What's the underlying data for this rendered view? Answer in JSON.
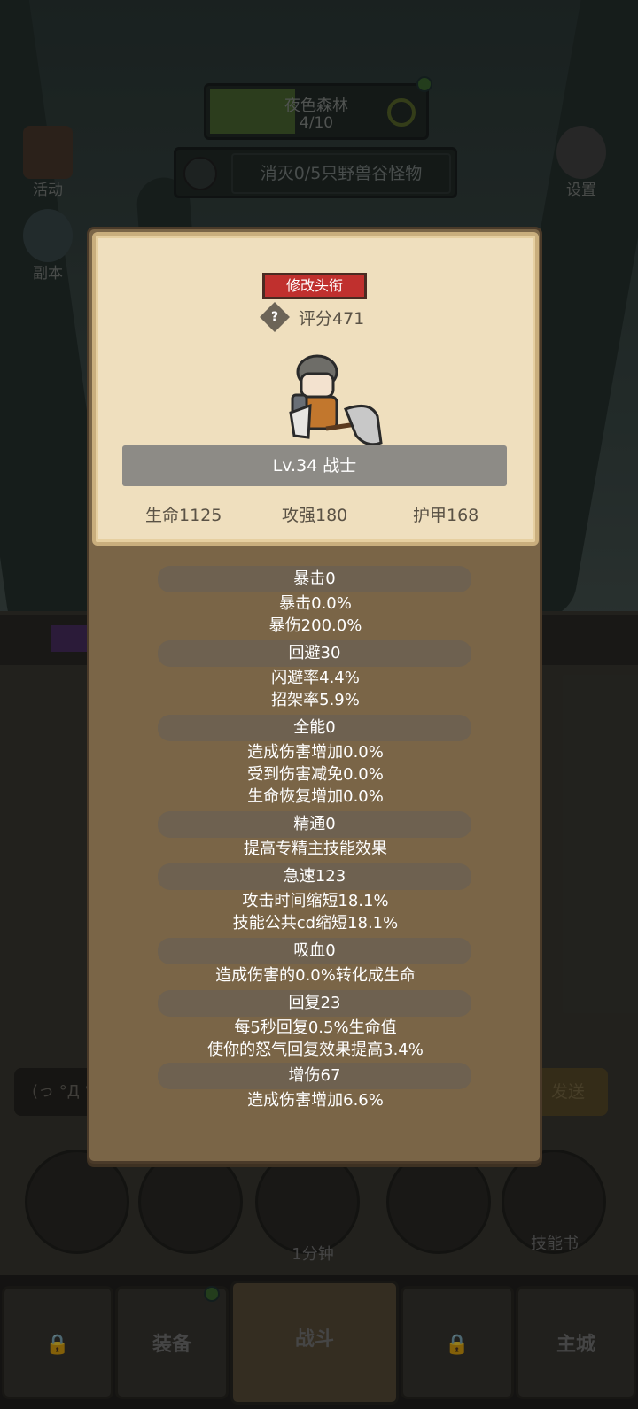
{
  "stage": {
    "name": "夜色森林",
    "progress": "4/10"
  },
  "quest": {
    "text": "消灭0/5只野兽谷怪物"
  },
  "side_left": [
    {
      "label": "活动",
      "icon": "calendar-icon"
    },
    {
      "label": "副本",
      "icon": "portal-icon"
    }
  ],
  "side_right": {
    "label": "设置",
    "icon": "gear-icon"
  },
  "chat": {
    "text": "(っ °Д °",
    "send_label": "发送"
  },
  "bottom_circles": {
    "timer_label": "1分钟",
    "skillbook_label": "技能书"
  },
  "nav": {
    "equipment": "装备",
    "battle": "战斗",
    "city": "主城"
  },
  "card": {
    "title_button": "修改头衔",
    "help": "?",
    "score": "评分471",
    "level": "Lv.34 战士",
    "stats": {
      "hp": "生命1125",
      "atk": "攻强180",
      "armor": "护甲168"
    }
  },
  "sections": [
    {
      "head": "暴击0",
      "lines": [
        "暴击0.0%",
        "暴伤200.0%"
      ]
    },
    {
      "head": "回避30",
      "lines": [
        "闪避率4.4%",
        "招架率5.9%"
      ]
    },
    {
      "head": "全能0",
      "lines": [
        "造成伤害增加0.0%",
        "受到伤害减免0.0%",
        "生命恢复增加0.0%"
      ]
    },
    {
      "head": "精通0",
      "lines": [
        "提高专精主技能效果"
      ]
    },
    {
      "head": "急速123",
      "lines": [
        "攻击时间缩短18.1%",
        "技能公共cd缩短18.1%"
      ]
    },
    {
      "head": "吸血0",
      "lines": [
        "造成伤害的0.0%转化成生命"
      ]
    },
    {
      "head": "回复23",
      "lines": [
        "每5秒回复0.5%生命值",
        "使你的怒气回复效果提高3.4%"
      ]
    },
    {
      "head": "增伤67",
      "lines": [
        "造成伤害增加6.6%"
      ]
    }
  ]
}
